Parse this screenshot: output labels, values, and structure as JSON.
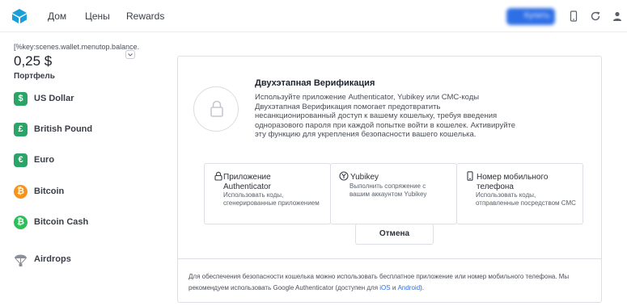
{
  "header": {
    "nav": [
      "Дом",
      "Цены",
      "Rewards"
    ],
    "cta_label": "Купить",
    "colors": {
      "brand": "#1b9fd8",
      "cta": "#2f6fe6"
    }
  },
  "sidebar": {
    "balance_key": "[%key:scenes.wallet.menutop.balance.",
    "balance_amount": "0,25 $",
    "portfolio_label": "Портфель",
    "wallets": [
      {
        "label": "US Dollar",
        "symbol": "$",
        "color": "#2aa567",
        "shape": "square"
      },
      {
        "label": "British Pound",
        "symbol": "£",
        "color": "#2aa567",
        "shape": "square"
      },
      {
        "label": "Euro",
        "symbol": "€",
        "color": "#2aa567",
        "shape": "square"
      },
      {
        "label": "Bitcoin",
        "symbol": "₿",
        "color": "#f7931a",
        "shape": "circle"
      },
      {
        "label": "Bitcoin Cash",
        "symbol": "₿",
        "color": "#2fbf58",
        "shape": "circle"
      },
      {
        "label": "Airdrops",
        "icon": "parachute-icon"
      }
    ]
  },
  "card": {
    "title": "Двухэтапная Верификация",
    "description": "Используйте приложение Authenticator, Yubikey или СМС-коды Двухэтапная Верификация помогает предотвратить несанкционированный доступ к вашему кошельку, требуя введения одноразового пароля при каждой попытке войти в кошелек. Активируйте эту функцию для укрепления безопасности вашего кошелька.",
    "options": {
      "app": {
        "title": "Приложение Authenticator",
        "sub": "Использовать коды, сгенерированные приложением",
        "icon": "lock-icon"
      },
      "yubikey": {
        "title": "Yubikey",
        "sub": "Выполнить сопряжение с вашим аккаунтом Yubikey",
        "icon": "yubikey-icon"
      },
      "phone": {
        "title": "Номер мобильного телефона",
        "sub": "Использовать коды, отправленные посредством СМС",
        "icon": "phone-icon"
      }
    },
    "cancel_label": "Отмена",
    "footer": {
      "text": "Для обеспечения безопасности кошелька можно использовать бесплатное приложение или номер мобильного телефона. Мы рекомендуем использовать Google Authenticator (доступен для",
      "ios": "iOS",
      "and": "и",
      "android": "Android",
      "end": ")."
    }
  }
}
